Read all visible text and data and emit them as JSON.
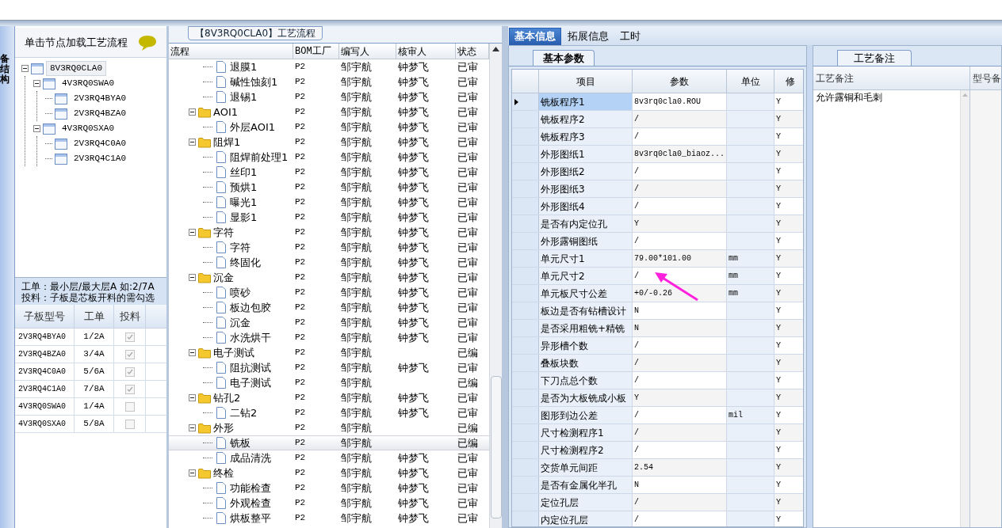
{
  "left_panel": {
    "side_tab": "备结构",
    "hint": "单击节点加载工艺流程",
    "tree": [
      {
        "label": "8V3RQ0CLA0",
        "selected": true,
        "expanded": true,
        "children": [
          {
            "label": "4V3RQ0SWA0",
            "selected": false,
            "expanded": true,
            "children": [
              {
                "label": "2V3RQ4BYA0",
                "selected": false
              },
              {
                "label": "2V3RQ4BZA0",
                "selected": false
              }
            ]
          },
          {
            "label": "4V3RQ0SXA0",
            "selected": false,
            "expanded": true,
            "children": [
              {
                "label": "2V3RQ4C0A0",
                "selected": false
              },
              {
                "label": "2V3RQ4C1A0",
                "selected": false
              }
            ]
          }
        ]
      }
    ],
    "note_lines": [
      "工单：最小层/最大层A 如:2/7A",
      "投料：子板是芯板开料的需勾选"
    ],
    "grid": {
      "columns": [
        "子板型号",
        "工单",
        "投料"
      ],
      "rows": [
        {
          "model": "2V3RQ4BYA0",
          "order": "1/2A",
          "checked": true
        },
        {
          "model": "2V3RQ4BZA0",
          "order": "3/4A",
          "checked": true
        },
        {
          "model": "2V3RQ4C0A0",
          "order": "5/6A",
          "checked": true
        },
        {
          "model": "2V3RQ4C1A0",
          "order": "7/8A",
          "checked": true
        },
        {
          "model": "4V3RQ0SWA0",
          "order": "1/4A",
          "checked": false
        },
        {
          "model": "4V3RQ0SXA0",
          "order": "5/8A",
          "checked": false
        }
      ]
    }
  },
  "flow_panel": {
    "title": "【8V3RQ0CLA0】工艺流程",
    "columns": [
      "流程",
      "BOM工厂",
      "编写人",
      "核审人",
      "状态"
    ],
    "groups": [
      {
        "children": [
          {
            "name": "退膜1",
            "bom": "P2",
            "writer": "邹宇航",
            "reviewer": "钟梦飞",
            "status": "已审",
            "selected": false
          },
          {
            "name": "碱性蚀刻1",
            "bom": "P2",
            "writer": "邹宇航",
            "reviewer": "钟梦飞",
            "status": "已审",
            "selected": false
          },
          {
            "name": "退锡1",
            "bom": "P2",
            "writer": "邹宇航",
            "reviewer": "钟梦飞",
            "status": "已审",
            "selected": false
          }
        ]
      },
      {
        "name": "AOI1",
        "bom": "P2",
        "writer": "邹宇航",
        "reviewer": "钟梦飞",
        "status": "已审",
        "expanded": true,
        "children": [
          {
            "name": "外层AOI1",
            "bom": "P2",
            "writer": "邹宇航",
            "reviewer": "钟梦飞",
            "status": "已审",
            "selected": false
          }
        ]
      },
      {
        "name": "阻焊1",
        "bom": "P2",
        "writer": "邹宇航",
        "reviewer": "钟梦飞",
        "status": "已审",
        "expanded": true,
        "children": [
          {
            "name": "阻焊前处理1",
            "bom": "P2",
            "writer": "邹宇航",
            "reviewer": "钟梦飞",
            "status": "已审",
            "selected": false
          },
          {
            "name": "丝印1",
            "bom": "P2",
            "writer": "邹宇航",
            "reviewer": "钟梦飞",
            "status": "已审",
            "selected": false
          },
          {
            "name": "预烘1",
            "bom": "P2",
            "writer": "邹宇航",
            "reviewer": "钟梦飞",
            "status": "已审",
            "selected": false
          },
          {
            "name": "曝光1",
            "bom": "P2",
            "writer": "邹宇航",
            "reviewer": "钟梦飞",
            "status": "已审",
            "selected": false
          },
          {
            "name": "显影1",
            "bom": "P2",
            "writer": "邹宇航",
            "reviewer": "钟梦飞",
            "status": "已审",
            "selected": false
          }
        ]
      },
      {
        "name": "字符",
        "bom": "P2",
        "writer": "邹宇航",
        "reviewer": "钟梦飞",
        "status": "已审",
        "expanded": true,
        "children": [
          {
            "name": "字符",
            "bom": "P2",
            "writer": "邹宇航",
            "reviewer": "钟梦飞",
            "status": "已审",
            "selected": false
          },
          {
            "name": "终固化",
            "bom": "P2",
            "writer": "邹宇航",
            "reviewer": "钟梦飞",
            "status": "已审",
            "selected": false
          }
        ]
      },
      {
        "name": "沉金",
        "bom": "P2",
        "writer": "邹宇航",
        "reviewer": "钟梦飞",
        "status": "已审",
        "expanded": true,
        "children": [
          {
            "name": "喷砂",
            "bom": "P2",
            "writer": "邹宇航",
            "reviewer": "钟梦飞",
            "status": "已审",
            "selected": false
          },
          {
            "name": "板边包胶",
            "bom": "P2",
            "writer": "邹宇航",
            "reviewer": "钟梦飞",
            "status": "已审",
            "selected": false
          },
          {
            "name": "沉金",
            "bom": "P2",
            "writer": "邹宇航",
            "reviewer": "钟梦飞",
            "status": "已审",
            "selected": false
          },
          {
            "name": "水洗烘干",
            "bom": "P2",
            "writer": "邹宇航",
            "reviewer": "钟梦飞",
            "status": "已审",
            "selected": false
          }
        ]
      },
      {
        "name": "电子测试",
        "bom": "P2",
        "writer": "邹宇航",
        "status": "已编",
        "expanded": true,
        "children": [
          {
            "name": "阻抗测试",
            "bom": "P2",
            "writer": "邹宇航",
            "reviewer": "钟梦飞",
            "status": "已审",
            "selected": false
          },
          {
            "name": "电子测试",
            "bom": "P2",
            "writer": "邹宇航",
            "status": "已编",
            "selected": false
          }
        ]
      },
      {
        "name": "钻孔2",
        "bom": "P2",
        "writer": "邹宇航",
        "reviewer": "钟梦飞",
        "status": "已审",
        "expanded": true,
        "children": [
          {
            "name": "二钻2",
            "bom": "P2",
            "writer": "邹宇航",
            "reviewer": "钟梦飞",
            "status": "已审",
            "selected": false
          }
        ]
      },
      {
        "name": "外形",
        "bom": "P2",
        "writer": "邹宇航",
        "status": "已编",
        "expanded": true,
        "children": [
          {
            "name": "铣板",
            "bom": "P2",
            "writer": "邹宇航",
            "status": "已编",
            "selected": true
          },
          {
            "name": "成品清洗",
            "bom": "P2",
            "writer": "邹宇航",
            "reviewer": "钟梦飞",
            "status": "已审",
            "selected": false
          }
        ]
      },
      {
        "name": "终检",
        "bom": "P2",
        "writer": "邹宇航",
        "reviewer": "钟梦飞",
        "status": "已审",
        "expanded": true,
        "children": [
          {
            "name": "功能检查",
            "bom": "P2",
            "writer": "邹宇航",
            "reviewer": "钟梦飞",
            "status": "已审",
            "selected": false
          },
          {
            "name": "外观检查",
            "bom": "P2",
            "writer": "邹宇航",
            "reviewer": "钟梦飞",
            "status": "已审",
            "selected": false
          },
          {
            "name": "烘板整平",
            "bom": "P2",
            "writer": "邹宇航",
            "reviewer": "钟梦飞",
            "status": "已审",
            "selected": false
          }
        ]
      }
    ]
  },
  "tabs": [
    {
      "label": "基本信息",
      "selected": true
    },
    {
      "label": "拓展信息",
      "selected": false
    },
    {
      "label": "工时",
      "selected": false
    }
  ],
  "params": {
    "tab": "基本参数",
    "columns": [
      "项目",
      "参数",
      "单位",
      "修"
    ],
    "rows": [
      {
        "item": "铣板程序1",
        "value": "8v3rq0cla0.ROU",
        "modify": "Y",
        "selected": true
      },
      {
        "item": "铣板程序2",
        "value": "/",
        "modify": "Y",
        "selected": false
      },
      {
        "item": "铣板程序3",
        "value": "/",
        "modify": "Y",
        "selected": false
      },
      {
        "item": "外形图纸1",
        "value": "8v3rq0cla0_biaoz...",
        "modify": "Y",
        "selected": false
      },
      {
        "item": "外形图纸2",
        "value": "/",
        "modify": "Y",
        "selected": false
      },
      {
        "item": "外形图纸3",
        "value": "/",
        "modify": "Y",
        "selected": false
      },
      {
        "item": "外形图纸4",
        "value": "/",
        "modify": "Y",
        "selected": false
      },
      {
        "item": "是否有内定位孔",
        "value": "Y",
        "modify": "Y",
        "selected": false
      },
      {
        "item": "外形露铜图纸",
        "value": "/",
        "modify": "Y",
        "selected": false
      },
      {
        "item": "单元尺寸1",
        "value": "79.00*101.00",
        "unit": "mm",
        "modify": "Y",
        "selected": false
      },
      {
        "item": "单元尺寸2",
        "value": "/",
        "unit": "mm",
        "modify": "Y",
        "selected": false
      },
      {
        "item": "单元板尺寸公差",
        "value": "+0/-0.26",
        "unit": "mm",
        "modify": "Y",
        "selected": false
      },
      {
        "item": "板边是否有钻槽设计",
        "value": "N",
        "modify": "Y",
        "selected": false
      },
      {
        "item": "是否采用粗铣+精铣",
        "value": "N",
        "modify": "Y",
        "selected": false
      },
      {
        "item": "异形槽个数",
        "value": "/",
        "modify": "Y",
        "selected": false
      },
      {
        "item": "叠板块数",
        "value": "/",
        "modify": "Y",
        "selected": false
      },
      {
        "item": "下刀点总个数",
        "value": "/",
        "modify": "Y",
        "selected": false
      },
      {
        "item": "是否为大板铣成小板",
        "value": "Y",
        "modify": "Y",
        "selected": false
      },
      {
        "item": "图形到边公差",
        "value": "/",
        "unit": "mil",
        "modify": "Y",
        "selected": false
      },
      {
        "item": "尺寸检测程序1",
        "value": "/",
        "modify": "Y",
        "selected": false
      },
      {
        "item": "尺寸检测程序2",
        "value": "/",
        "modify": "Y",
        "selected": false
      },
      {
        "item": "交货单元间距",
        "value": "2.54",
        "modify": "Y",
        "selected": false
      },
      {
        "item": "是否有金属化半孔",
        "value": "N",
        "modify": "Y",
        "selected": false
      },
      {
        "item": "定位孔层",
        "value": "/",
        "modify": "Y",
        "selected": false
      },
      {
        "item": "内定位孔层",
        "value": "/",
        "modify": "Y",
        "selected": false
      }
    ]
  },
  "notes": {
    "tab": "工艺备注",
    "columns": [
      "工艺备注",
      "型号备"
    ],
    "rows": [
      {
        "note": "允许露铜和毛刺"
      }
    ]
  }
}
